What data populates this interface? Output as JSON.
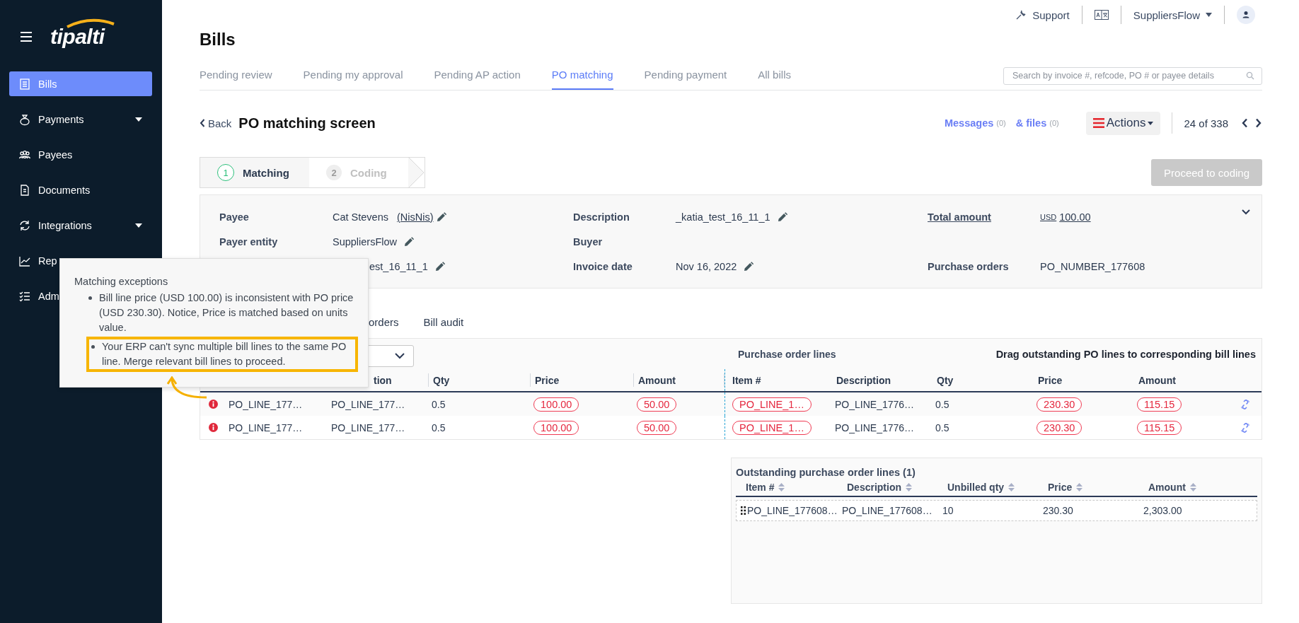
{
  "sidebar": {
    "logo": "tipalti",
    "items": [
      {
        "label": "Bills",
        "selected": true,
        "expandable": false
      },
      {
        "label": "Payments",
        "selected": false,
        "expandable": true
      },
      {
        "label": "Payees",
        "selected": false,
        "expandable": false
      },
      {
        "label": "Documents",
        "selected": false,
        "expandable": false
      },
      {
        "label": "Integrations",
        "selected": false,
        "expandable": true
      },
      {
        "label": "Rep",
        "selected": false,
        "expandable": false
      },
      {
        "label": "Adm",
        "selected": false,
        "expandable": false
      }
    ]
  },
  "top_bar": {
    "support": "Support",
    "account": "SuppliersFlow"
  },
  "page_title": "Bills",
  "tabs": [
    {
      "label": "Pending review",
      "selected": false
    },
    {
      "label": "Pending my approval",
      "selected": false
    },
    {
      "label": "Pending AP action",
      "selected": false
    },
    {
      "label": "PO matching",
      "selected": true
    },
    {
      "label": "Pending payment",
      "selected": false
    },
    {
      "label": "All bills",
      "selected": false
    }
  ],
  "search": {
    "placeholder": "Search by invoice #, refcode, PO # or payee details"
  },
  "header": {
    "back": "Back",
    "title": "PO matching screen",
    "messages": {
      "label": "Messages",
      "count": "(0)"
    },
    "files": {
      "label": "& files",
      "count": "(0)"
    },
    "actions": "Actions",
    "pager": "24 of 338"
  },
  "stepper": [
    {
      "number": "1",
      "label": "Matching",
      "selected": true
    },
    {
      "number": "2",
      "label": "Coding",
      "selected": false
    }
  ],
  "proceed_button": {
    "label": "Proceed to coding",
    "disabled": true
  },
  "details": [
    [
      {
        "label": "Payee",
        "value": "Cat Stevens",
        "link": "(NisNis)",
        "editable": true
      },
      {
        "label": "Description",
        "value": "_katia_test_16_11_1",
        "editable": true
      },
      {
        "label": "Total amount",
        "currency": "USD",
        "value": "100.00",
        "underlined": true,
        "editable": false
      }
    ],
    [
      {
        "label": "Payer entity",
        "value": "SuppliersFlow",
        "editable": true
      },
      {
        "label": "Buyer",
        "editable": false
      }
    ],
    [
      {
        "value": "est_16_11_1",
        "editable": true
      },
      {
        "label": "Invoice date",
        "value": "Nov 16, 2022",
        "editable": true
      },
      {
        "label": "Purchase orders",
        "value": "PO_NUMBER_177608",
        "editable": false
      }
    ]
  ],
  "section_tabs": [
    {
      "label": "orders"
    },
    {
      "label": "Bill audit"
    }
  ],
  "matching": {
    "po_title": "Purchase order lines",
    "hint": "Drag outstanding PO lines to corresponding bill lines",
    "bill_columns": [
      "tion",
      "Qty",
      "Price",
      "Amount"
    ],
    "po_columns": [
      "Item #",
      "Description",
      "Qty",
      "Price",
      "Amount"
    ],
    "rows": [
      {
        "exception": true,
        "linked": true,
        "bill": [
          {
            "text": "PO_LINE_177…",
            "flagged": false
          },
          {
            "text": "PO_LINE_177…",
            "flagged": false
          },
          {
            "text": "0.5",
            "flagged": false
          },
          {
            "text": "100.00",
            "flagged": true
          },
          {
            "text": "50.00",
            "flagged": true
          }
        ],
        "po": [
          {
            "text": "PO_LINE_1…",
            "flagged": true
          },
          {
            "text": "PO_LINE_1776…",
            "flagged": false
          },
          {
            "text": "0.5",
            "flagged": false
          },
          {
            "text": "230.30",
            "flagged": true
          },
          {
            "text": "115.15",
            "flagged": true
          }
        ]
      },
      {
        "exception": true,
        "linked": true,
        "bill": [
          {
            "text": "PO_LINE_177…",
            "flagged": false
          },
          {
            "text": "PO_LINE_177…",
            "flagged": false
          },
          {
            "text": "0.5",
            "flagged": false
          },
          {
            "text": "100.00",
            "flagged": true
          },
          {
            "text": "50.00",
            "flagged": true
          }
        ],
        "po": [
          {
            "text": "PO_LINE_1…",
            "flagged": true
          },
          {
            "text": "PO_LINE_1776…",
            "flagged": false
          },
          {
            "text": "0.5",
            "flagged": false
          },
          {
            "text": "230.30",
            "flagged": true
          },
          {
            "text": "115.15",
            "flagged": true
          }
        ]
      }
    ]
  },
  "outstanding": {
    "title": "Outstanding purchase order lines (1)",
    "columns": [
      "Item #",
      "Description",
      "Unbilled qty",
      "Price",
      "Amount"
    ],
    "rows": [
      [
        "PO_LINE_177608…",
        "PO_LINE_177608…",
        "10",
        "230.30",
        "2,303.00"
      ]
    ]
  },
  "tooltip": {
    "title": "Matching exceptions",
    "items": [
      {
        "text": "Bill line price (USD 100.00) is inconsistent with PO price (USD 230.30). Notice, Price is matched based on units value.",
        "highlighted": false
      },
      {
        "text": "Your ERP can't sync multiple bill lines to the same PO line. Merge relevant bill lines to proceed.",
        "highlighted": true
      }
    ]
  }
}
